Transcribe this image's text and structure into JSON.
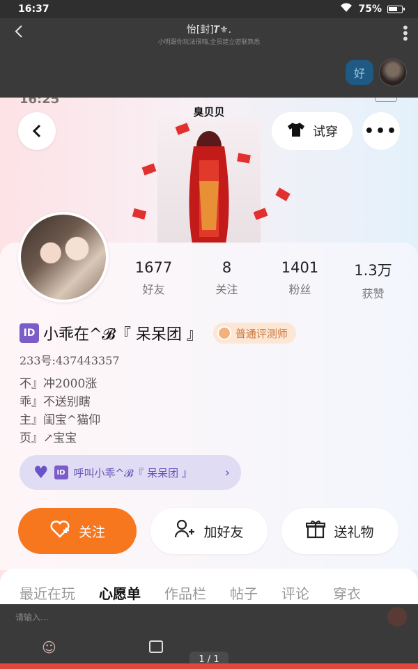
{
  "status_bar": {
    "time": "16:37",
    "battery": "75%"
  },
  "chat": {
    "title": "怡[封]𝑻⚜.",
    "subtitle": "小明跟你玩法很嗨,全员建立密联熟悉",
    "bubble_text": "好",
    "input_placeholder": "请输入...",
    "page_indicator": "1 / 1"
  },
  "screenshot": {
    "status_time": "16:25",
    "brand_label": "臭贝贝",
    "try_on_label": "试穿",
    "stats": [
      {
        "value": "1677",
        "label": "好友"
      },
      {
        "value": "8",
        "label": "关注"
      },
      {
        "value": "1401",
        "label": "粉丝"
      },
      {
        "value": "1.3万",
        "label": "获赞"
      }
    ],
    "id_badge": "ID",
    "name": "小乖在^𝓑『 呆呆团 』",
    "rank_badge": "普通评测师",
    "uid": "233号:437443357",
    "bio_lines": [
      "不』冲2000涨",
      "乖』不送别瞎",
      "主』闺宝^猫仰",
      "页』↗宝宝"
    ],
    "call_chip": "呼叫小乖^𝓑『 呆呆团 』",
    "buttons": {
      "follow": "关注",
      "add_friend": "加好友",
      "gift": "送礼物"
    },
    "tabs": [
      "最近在玩",
      "心愿单",
      "作品栏",
      "帖子",
      "评论",
      "穿衣"
    ],
    "active_tab": "心愿单"
  },
  "colors": {
    "accent": "#f7771e",
    "id_badge": "#7b5cc9",
    "chip_bg": "#e0dcf4",
    "bottom_bar": "#e3473b"
  }
}
